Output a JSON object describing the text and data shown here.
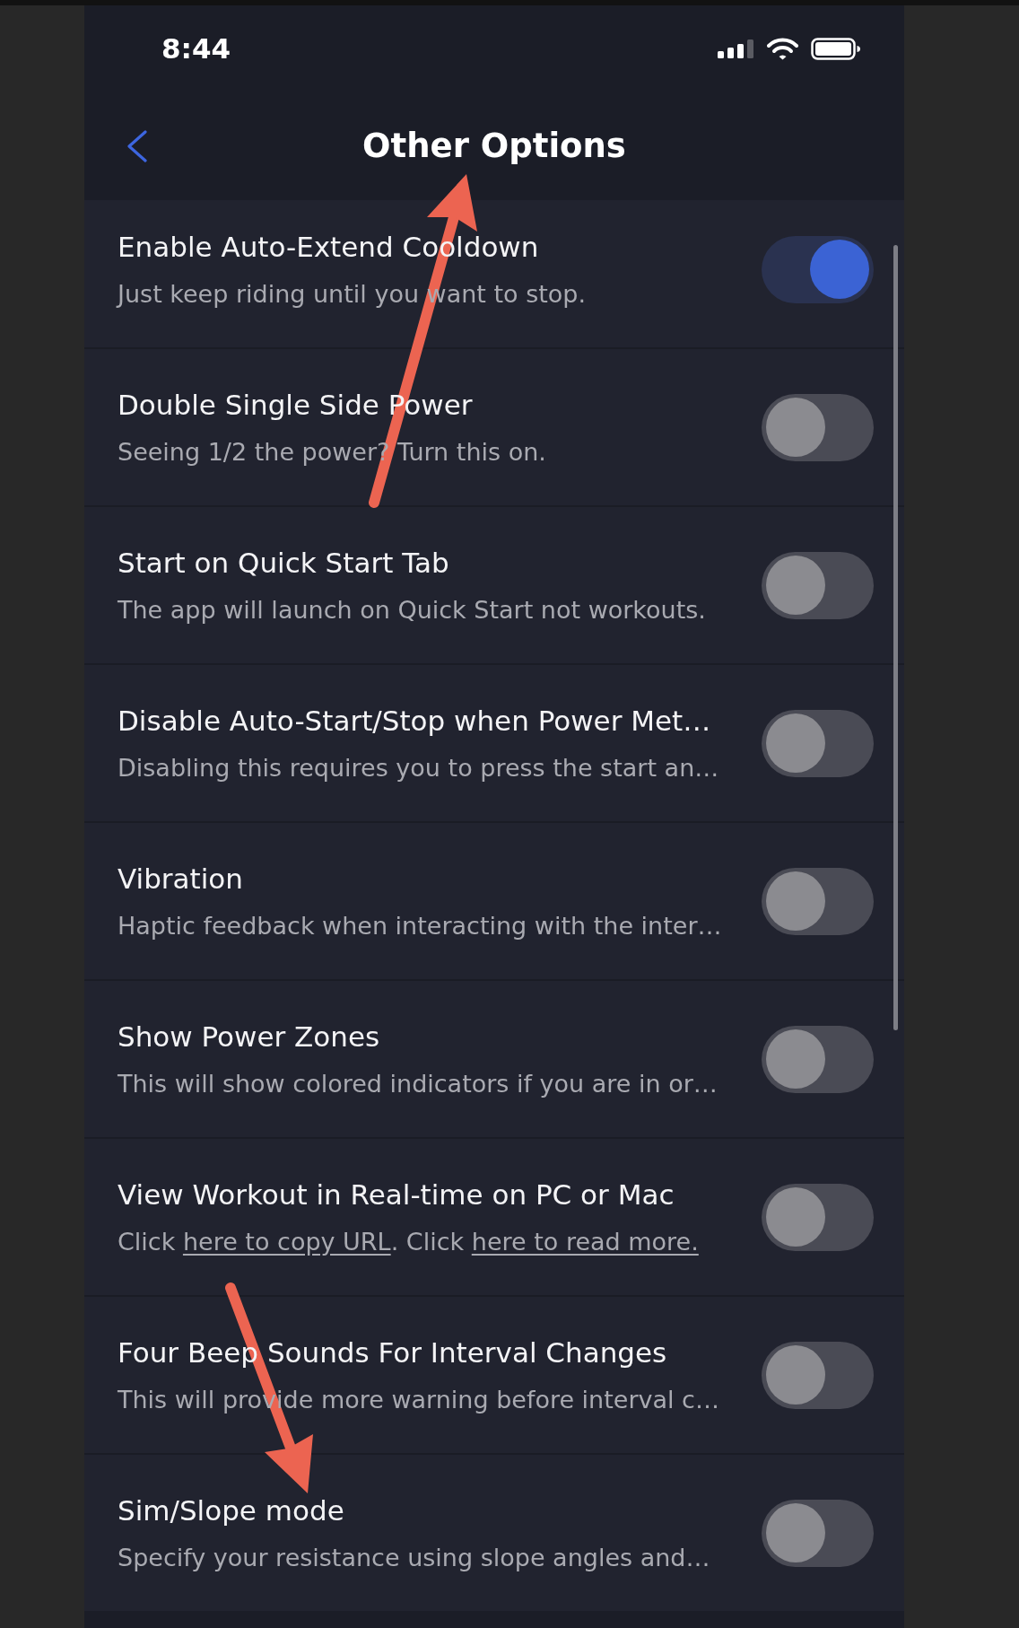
{
  "status_bar": {
    "time": "8:44"
  },
  "header": {
    "title": "Other Options"
  },
  "settings": [
    {
      "title": "Enable Auto-Extend Cooldown",
      "description": "Just keep riding until you want to stop.",
      "on": true
    },
    {
      "title": "Double Single Side Power",
      "description": "Seeing 1/2 the power? Turn this on.",
      "on": false
    },
    {
      "title": "Start on Quick Start Tab",
      "description": "The app will launch on Quick Start not workouts.",
      "on": false
    },
    {
      "title": "Disable Auto-Start/Stop when Power Met…",
      "description": "Disabling this requires you to press the start an…",
      "on": false
    },
    {
      "title": "Vibration",
      "description": "Haptic feedback when interacting with the inter…",
      "on": false
    },
    {
      "title": "Show Power Zones",
      "description": "This will show colored indicators if you are in or…",
      "on": false
    },
    {
      "title": "View Workout in Real-time on PC or Mac",
      "description_parts": [
        {
          "kind": "text",
          "text": "Click "
        },
        {
          "kind": "link",
          "text": "here to copy URL"
        },
        {
          "kind": "text",
          "text": ". Click "
        },
        {
          "kind": "link",
          "text": "here to read more."
        }
      ],
      "on": false
    },
    {
      "title": "Four Beep Sounds For Interval Changes",
      "description": "This will provide more warning before interval c…",
      "on": false
    },
    {
      "title": "Sim/Slope mode",
      "description": "Specify your resistance using slope angles and…",
      "on": false
    }
  ]
}
